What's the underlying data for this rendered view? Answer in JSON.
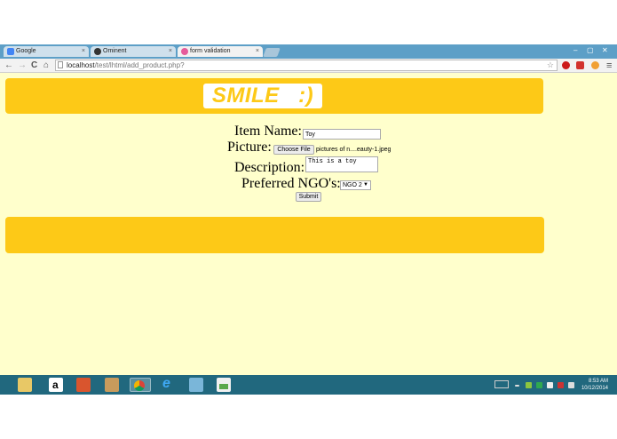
{
  "browser": {
    "tabs": [
      {
        "title": "Google",
        "favicon_color": "#4285f4",
        "active": false
      },
      {
        "title": "Ominent",
        "favicon_color": "#333333",
        "active": false
      },
      {
        "title": "form validation",
        "favicon_color": "#e65c9c",
        "active": true
      }
    ],
    "tab_close_glyph": "×",
    "window_controls": [
      "–",
      "▢",
      "✕"
    ],
    "nav": {
      "back": "←",
      "forward": "→",
      "reload": "C",
      "home": "⌂"
    },
    "url": {
      "host": "localhost",
      "path": "/test/lhtml/add_product.php?"
    },
    "star": "☆",
    "menu": "≡",
    "extension_icons": [
      "opera-icon",
      "adblock-icon",
      "chrome-ext-icon"
    ]
  },
  "page": {
    "logo": "SMILE   :)",
    "colors": {
      "background": "#ffffcc",
      "banner": "#fdc917",
      "logo_bg": "#ffffff"
    },
    "form": {
      "item_name_label": "Item Name:",
      "item_name_value": "Toy",
      "picture_label": "Picture:",
      "choose_file_label": "Choose File",
      "file_name": "pictures of n....eauty-1.jpeg",
      "description_label": "Description:",
      "description_value": "This is a toy",
      "ngo_label": "Preferred NGO's:",
      "ngo_selected": "NGO 2",
      "submit_label": "Submit"
    }
  },
  "taskbar": {
    "apps": [
      "file-explorer-icon",
      "amazon-icon",
      "store-icon",
      "paint-icon",
      "chrome-icon",
      "internet-explorer-icon",
      "notes-icon",
      "image-viewer-icon"
    ],
    "time": "8:53 AM",
    "date": "10/12/2014"
  }
}
